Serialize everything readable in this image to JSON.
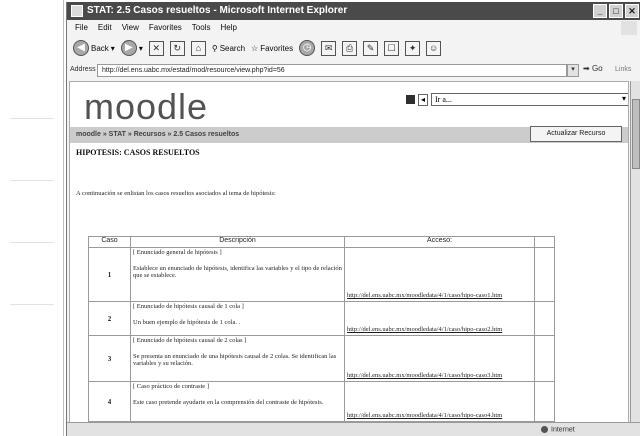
{
  "window": {
    "title": "STAT: 2.5 Casos resueltos - Microsoft Internet Explorer",
    "controls": [
      "_",
      "□",
      "✕"
    ]
  },
  "menu": [
    "File",
    "Edit",
    "View",
    "Favorites",
    "Tools",
    "Help"
  ],
  "toolbar": {
    "back": "Back",
    "search": "Search",
    "favorites": "Favorites"
  },
  "address": {
    "label": "Address",
    "url": "http://del.ens.uabc.mx/estad/mod/resource/view.php?id=56",
    "go": "Go",
    "links": "Links"
  },
  "moodle": {
    "logo": "moodle",
    "jump_value": "Ir a...",
    "breadcrumb": "moodle » STAT » Recursos » 2.5 Casos resueltos",
    "update_button": "Actualizar Recurso"
  },
  "page": {
    "heading": "HIPOTESIS: CASOS RESUELTOS",
    "intro": "A continuación se enlistan los casos resueltos asociados al tema de hipótesis:"
  },
  "table": {
    "headers": [
      "Caso",
      "Descripción",
      "Acceso:"
    ],
    "rows": [
      {
        "caso": "1",
        "title": "[ Enunciado general de hipótesis ]",
        "desc": "Establece un enunciado de hipótesis, identifica las variables y el tipo de relación que se establece.",
        "url": "http://del.ens.uabc.mx/moodledata/4/1/caso/hipo-caso1.htm"
      },
      {
        "caso": "2",
        "title": "[ Enunciado de hipótesis causal de 1 cola ]",
        "desc": "Un buen ejemplo de hipótesis de 1 cola. .",
        "url": "http://del.ens.uabc.mx/moodledata/4/1/caso/hipo-caso2.htm"
      },
      {
        "caso": "3",
        "title": "[ Enunciado de hipótesis causal de 2 colas ]",
        "desc": "Se presenta un enunciado de una hipótesis causal de 2 colas. Se identifican las variables y su relación.",
        "url": "http://del.ens.uabc.mx/moodledata/4/1/caso/hipo-caso3.htm"
      },
      {
        "caso": "4",
        "title": "[ Caso práctico de contraste ]",
        "desc": "Este caso pretende ayudarte en la comprensión del contraste de hipótesis.",
        "url": "http://del.ens.uabc.mx/moodledata/4/1/caso/hipo-caso4.htm"
      }
    ]
  },
  "status": {
    "left": "",
    "zone": "Internet"
  }
}
